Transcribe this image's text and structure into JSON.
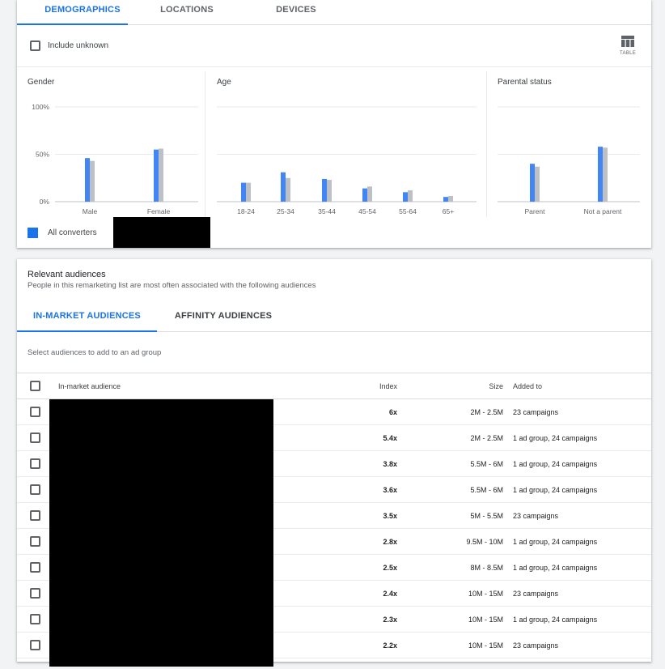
{
  "top_tabs": [
    "DEMOGRAPHICS",
    "LOCATIONS",
    "DEVICES"
  ],
  "include_unknown_label": "Include unknown",
  "table_button_label": "TABLE",
  "panels": {
    "gender": {
      "title": "Gender"
    },
    "age": {
      "title": "Age"
    },
    "parental": {
      "title": "Parental status"
    }
  },
  "legend": {
    "label": "All converters",
    "color": "#1a73e8"
  },
  "colors": {
    "series_primary": "#4285f4",
    "series_secondary": "#bdc1c6",
    "accent": "#1a73e8"
  },
  "chart_data": [
    {
      "type": "bar",
      "title": "Gender",
      "categories": [
        "Male",
        "Female"
      ],
      "series": [
        {
          "name": "All converters",
          "values": [
            46,
            55
          ]
        },
        {
          "values": [
            43,
            56
          ]
        }
      ],
      "ylim": [
        0,
        100
      ],
      "yticks": [
        "100%",
        "50%",
        "0%"
      ],
      "grid": true
    },
    {
      "type": "bar",
      "title": "Age",
      "categories": [
        "18-24",
        "25-34",
        "35-44",
        "45-54",
        "55-64",
        "65+"
      ],
      "series": [
        {
          "name": "All converters",
          "values": [
            20,
            31,
            24,
            14,
            10,
            5
          ]
        },
        {
          "values": [
            20,
            25,
            23,
            16,
            12,
            6
          ]
        }
      ],
      "ylim": [
        0,
        100
      ],
      "grid": true
    },
    {
      "type": "bar",
      "title": "Parental status",
      "categories": [
        "Parent",
        "Not a parent"
      ],
      "series": [
        {
          "name": "All converters",
          "values": [
            40,
            58
          ]
        },
        {
          "values": [
            37,
            57
          ]
        }
      ],
      "ylim": [
        0,
        100
      ],
      "grid": true
    }
  ],
  "audiences": {
    "title": "Relevant audiences",
    "subtitle": "People in this remarketing list are most often associated with the following audiences",
    "tabs": [
      "IN-MARKET AUDIENCES",
      "AFFINITY AUDIENCES"
    ],
    "hint": "Select audiences to add to an ad group",
    "columns": {
      "name": "In-market audience",
      "index": "Index",
      "size": "Size",
      "added": "Added to"
    },
    "rows": [
      {
        "index": "6x",
        "size": "2M - 2.5M",
        "added": "23 campaigns"
      },
      {
        "index": "5.4x",
        "size": "2M - 2.5M",
        "added": "1 ad group, 24 campaigns"
      },
      {
        "index": "3.8x",
        "size": "5.5M - 6M",
        "added": "1 ad group, 24 campaigns"
      },
      {
        "index": "3.6x",
        "size": "5.5M - 6M",
        "added": "1 ad group, 24 campaigns"
      },
      {
        "index": "3.5x",
        "size": "5M - 5.5M",
        "added": "23 campaigns"
      },
      {
        "index": "2.8x",
        "size": "9.5M - 10M",
        "added": "1 ad group, 24 campaigns"
      },
      {
        "index": "2.5x",
        "size": "8M - 8.5M",
        "added": "1 ad group, 24 campaigns"
      },
      {
        "index": "2.4x",
        "size": "10M - 15M",
        "added": "23 campaigns"
      },
      {
        "index": "2.3x",
        "size": "10M - 15M",
        "added": "1 ad group, 24 campaigns"
      },
      {
        "index": "2.2x",
        "size": "10M - 15M",
        "added": "23 campaigns"
      }
    ]
  }
}
